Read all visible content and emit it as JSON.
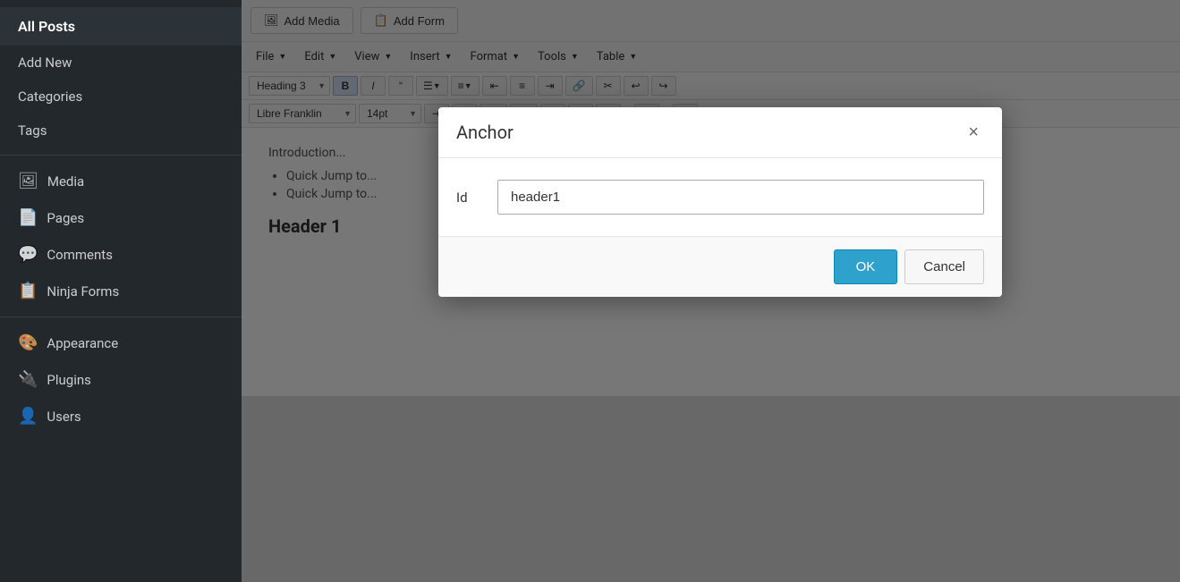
{
  "sidebar": {
    "items": [
      {
        "id": "all-posts",
        "label": "All Posts",
        "icon": "",
        "active": true,
        "top": true
      },
      {
        "id": "add-new",
        "label": "Add New",
        "icon": ""
      },
      {
        "id": "categories",
        "label": "Categories",
        "icon": ""
      },
      {
        "id": "tags",
        "label": "Tags",
        "icon": ""
      },
      {
        "id": "media",
        "label": "Media",
        "icon": "🖼"
      },
      {
        "id": "pages",
        "label": "Pages",
        "icon": "📄"
      },
      {
        "id": "comments",
        "label": "Comments",
        "icon": "💬"
      },
      {
        "id": "ninja-forms",
        "label": "Ninja Forms",
        "icon": "📋"
      },
      {
        "id": "appearance",
        "label": "Appearance",
        "icon": "🎨"
      },
      {
        "id": "plugins",
        "label": "Plugins",
        "icon": "🔌"
      },
      {
        "id": "users",
        "label": "Users",
        "icon": "👤"
      }
    ]
  },
  "toolbar": {
    "add_media_label": "Add Media",
    "add_form_label": "Add Form",
    "menus": [
      "File",
      "Edit",
      "View",
      "Insert",
      "Format",
      "Tools",
      "Table"
    ],
    "heading_select": "Heading 3",
    "font_select": "Libre Franklin",
    "size_select": "14pt",
    "bold_icon": "B",
    "italic_icon": "I",
    "quote_icon": "❝"
  },
  "editor": {
    "intro_text": "Introduction...",
    "list_items": [
      "Quick Jump to...",
      "Quick Jump to..."
    ],
    "header1_text": "Header 1"
  },
  "modal": {
    "title": "Anchor",
    "close_icon": "×",
    "id_label": "Id",
    "id_value": "header1",
    "ok_label": "OK",
    "cancel_label": "Cancel"
  }
}
